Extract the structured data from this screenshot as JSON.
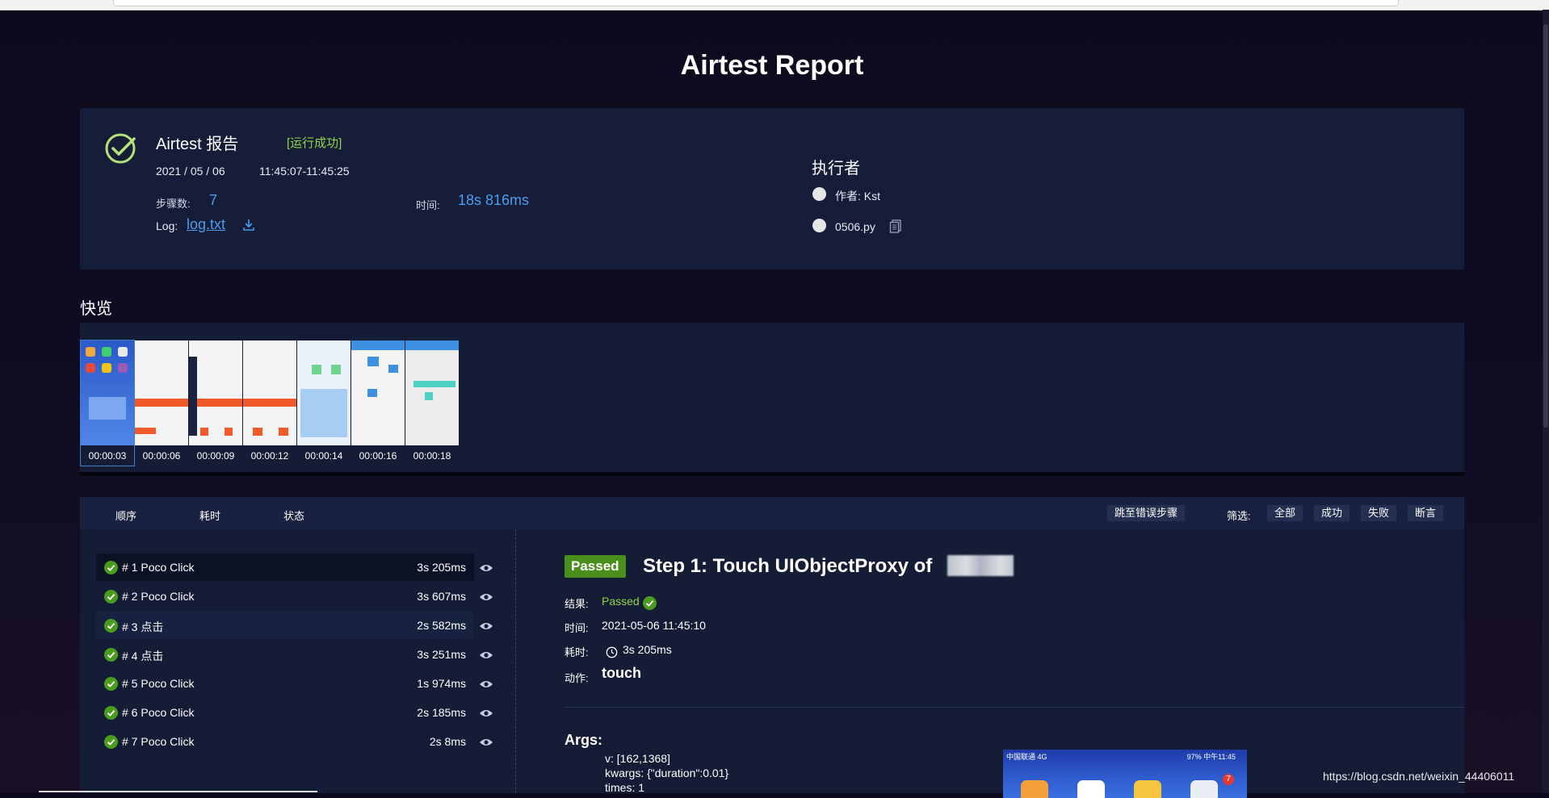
{
  "page_title": "Airtest Report",
  "summary": {
    "report_title": "Airtest 报告",
    "run_status": "[运行成功]",
    "date": "2021 / 05 / 06",
    "time_range": "11:45:07-11:45:25",
    "steps_label": "步骤数:",
    "steps_value": "7",
    "duration_label": "时间:",
    "duration_value": "18s 816ms",
    "log_label": "Log:",
    "log_link": "log.txt"
  },
  "executor": {
    "title": "执行者",
    "author": "作者: Kst",
    "script": "0506.py"
  },
  "overview": {
    "title": "快览",
    "thumbnails": [
      {
        "time": "00:00:03"
      },
      {
        "time": "00:00:06"
      },
      {
        "time": "00:00:09"
      },
      {
        "time": "00:00:12"
      },
      {
        "time": "00:00:14"
      },
      {
        "time": "00:00:16"
      },
      {
        "time": "00:00:18"
      }
    ]
  },
  "steps_header": {
    "order": "顺序",
    "duration": "耗时",
    "status": "状态",
    "jump_error": "跳至错误步骤",
    "filter_label": "筛选:",
    "filter_all": "全部",
    "filter_success": "成功",
    "filter_fail": "失败",
    "filter_assert": "断言"
  },
  "steps": [
    {
      "label": "# 1 Poco Click",
      "time": "3s 205ms"
    },
    {
      "label": "# 2 Poco Click",
      "time": "3s 607ms"
    },
    {
      "label": "# 3 点击",
      "time": "2s 582ms"
    },
    {
      "label": "# 4 点击",
      "time": "3s 251ms"
    },
    {
      "label": "# 5 Poco Click",
      "time": "1s 974ms"
    },
    {
      "label": "# 6 Poco Click",
      "time": "2s 185ms"
    },
    {
      "label": "# 7 Poco Click",
      "time": "2s 8ms"
    }
  ],
  "detail": {
    "badge": "Passed",
    "title": "Step 1: Touch UIObjectProxy of",
    "result_label": "结果:",
    "result_value": "Passed",
    "time_label": "时间:",
    "time_value": "2021-05-06 11:45:10",
    "duration_label": "耗时:",
    "duration_value": "3s 205ms",
    "action_label": "动作:",
    "action_value": "touch",
    "args_title": "Args:",
    "args": [
      "v: [162,1368]",
      "kwargs: {\"duration\":0.01}",
      "times: 1"
    ],
    "phone_status_left": "中国联通 4G",
    "phone_status_right": "97% 中午11:45",
    "phone_badge": "7"
  },
  "watermark": "https://blog.csdn.net/weixin_44406011",
  "colors": {
    "accent_blue": "#4a9df0",
    "success_green": "#8fd44a",
    "badge_green": "#4a8e1c",
    "panel_bg": "#151d38"
  }
}
